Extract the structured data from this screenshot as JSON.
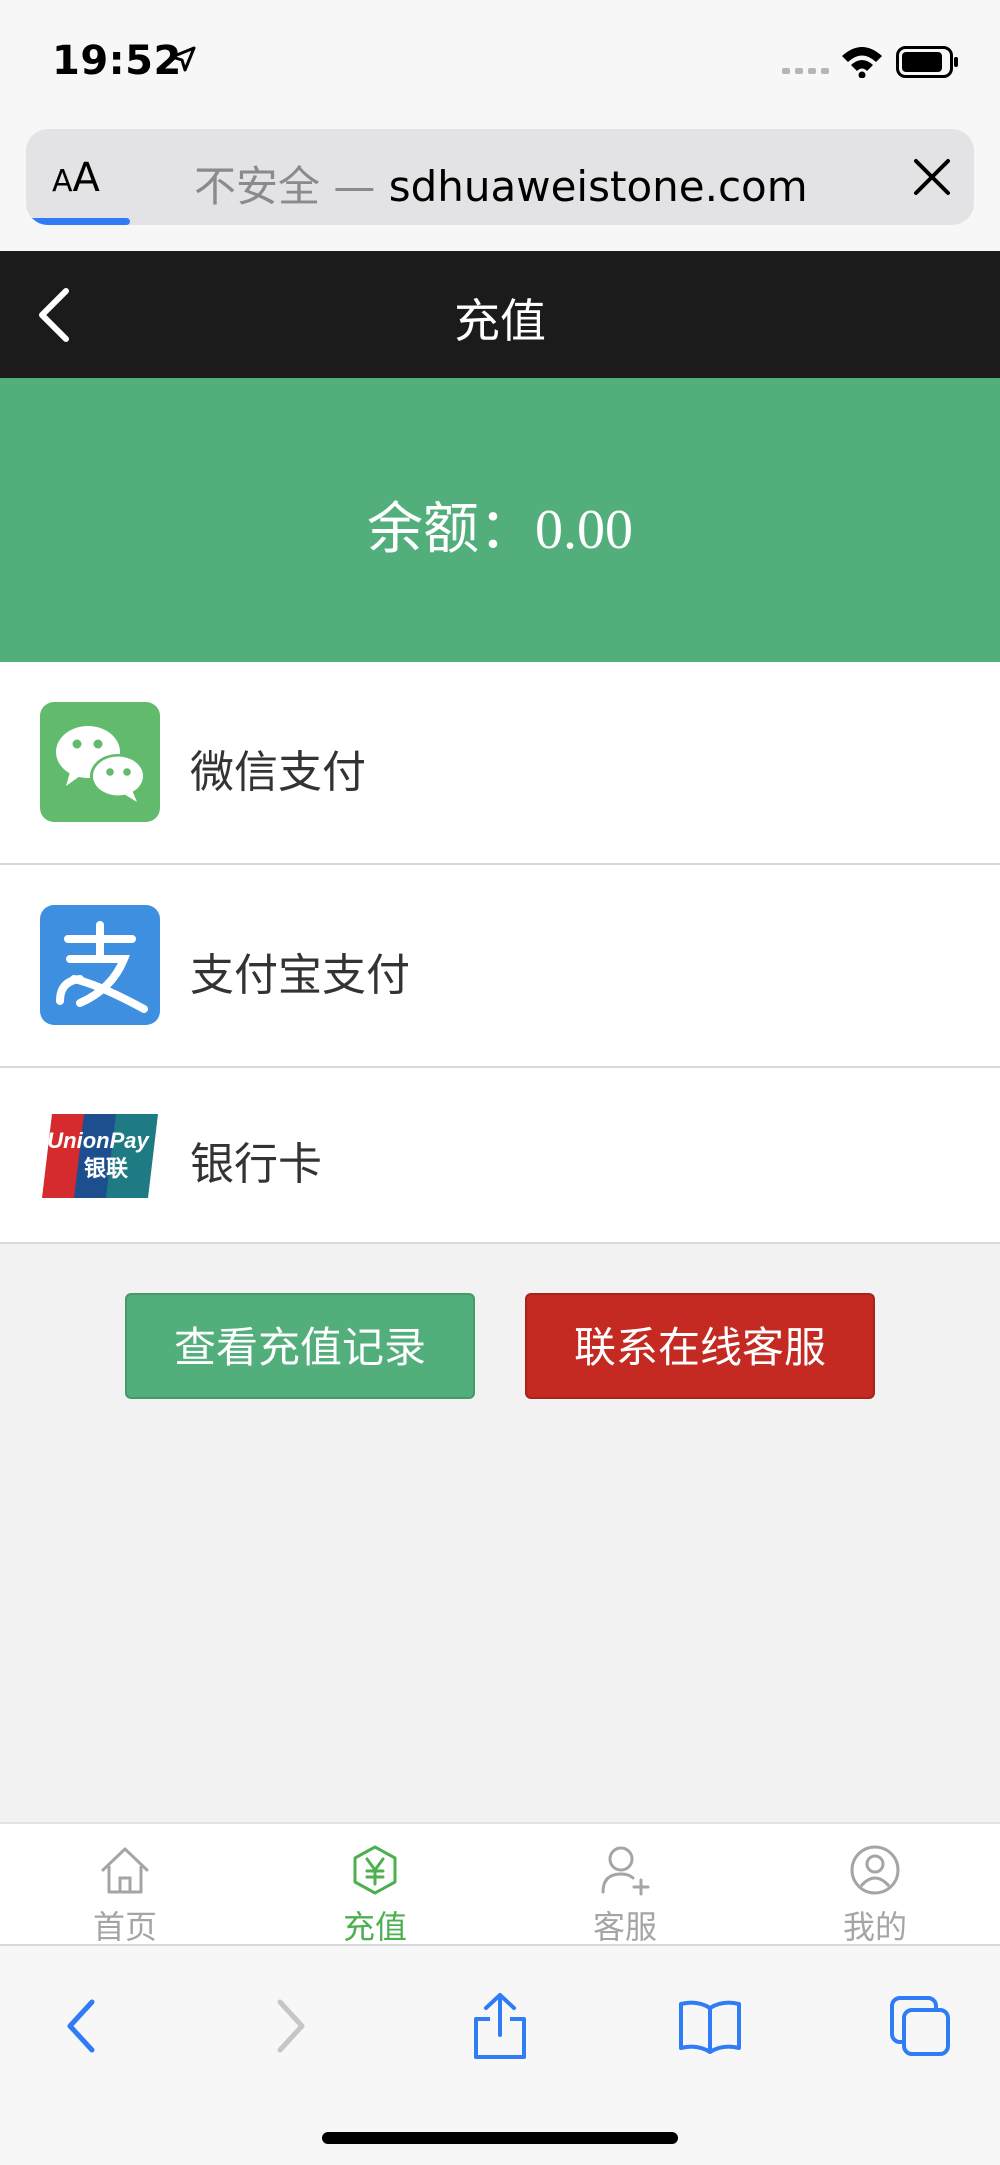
{
  "status_bar": {
    "time": "19:52"
  },
  "address_bar": {
    "text_size_label": "AA",
    "insecure_label": "不安全 —",
    "domain": "sdhuaweistone.com",
    "load_progress": 0.11
  },
  "header": {
    "title": "充值"
  },
  "balance": {
    "label": "余额：",
    "value": "0.00"
  },
  "payment_methods": [
    {
      "label": "微信支付",
      "icon": "wechat-pay-icon"
    },
    {
      "label": "支付宝支付",
      "icon": "alipay-icon"
    },
    {
      "label": "银行卡",
      "icon": "unionpay-icon",
      "icon_text_top": "UnionPay",
      "icon_text_bottom": "银联"
    }
  ],
  "buttons": {
    "records": "查看充值记录",
    "service": "联系在线客服"
  },
  "tabbar": {
    "items": [
      {
        "label": "首页",
        "icon": "home-icon",
        "active": false
      },
      {
        "label": "充值",
        "icon": "recharge-yen-icon",
        "active": true
      },
      {
        "label": "客服",
        "icon": "customer-service-icon",
        "active": false
      },
      {
        "label": "我的",
        "icon": "profile-icon",
        "active": false
      }
    ]
  },
  "colors": {
    "brand_green": "#52ae7b",
    "service_red": "#c42a22",
    "active_tab": "#4caf50",
    "ios_blue": "#2f7cf6"
  }
}
